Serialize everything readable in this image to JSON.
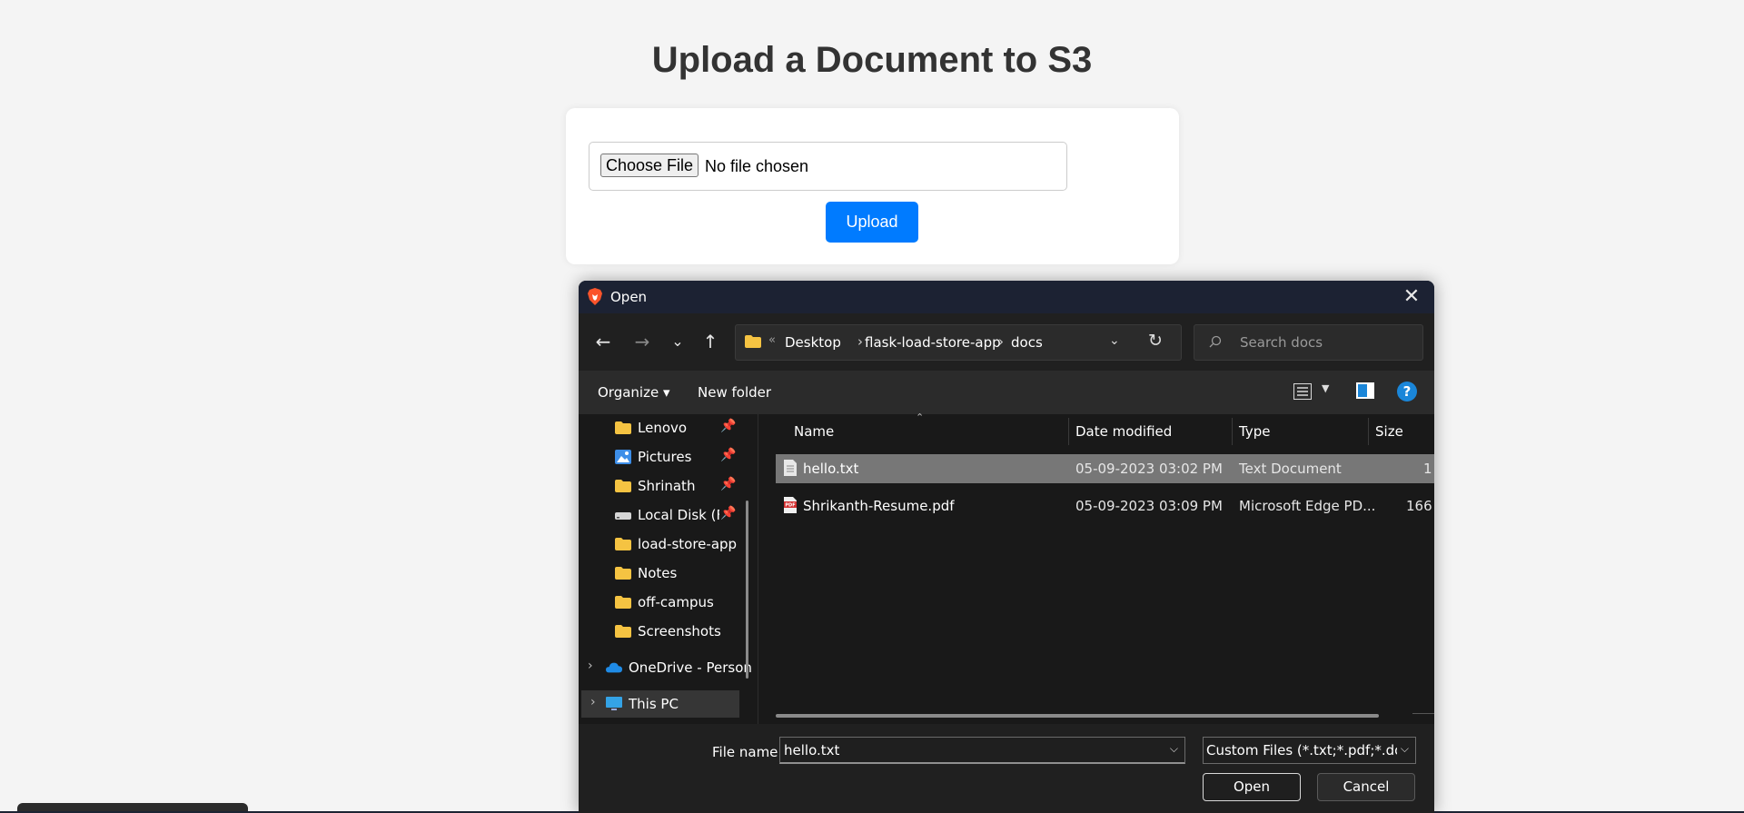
{
  "page": {
    "title": "Upload a Document to S3",
    "choose_file_label": "Choose File",
    "no_file_text": "No file chosen",
    "upload_label": "Upload"
  },
  "dialog": {
    "title": "Open",
    "close_glyph": "✕",
    "nav": {
      "back": "←",
      "forward": "→",
      "recent": "⌄",
      "up": "↑"
    },
    "address": {
      "overflow": "«",
      "crumbs": [
        "Desktop",
        "flask-load-store-app",
        "docs"
      ],
      "separator": "›"
    },
    "search_placeholder": "Search docs",
    "commands": {
      "organize": "Organize ▾",
      "new_folder": "New folder",
      "help": "?"
    },
    "nav_items": [
      {
        "label": "Lenovo",
        "icon": "folder-icon",
        "pinned": true
      },
      {
        "label": "Pictures",
        "icon": "pictures-icon",
        "pinned": true
      },
      {
        "label": "Shrinath",
        "icon": "folder-icon",
        "pinned": true
      },
      {
        "label": "Local Disk (F:)",
        "icon": "drive-icon",
        "pinned": true
      },
      {
        "label": "load-store-app",
        "icon": "folder-icon",
        "pinned": false
      },
      {
        "label": "Notes",
        "icon": "folder-icon",
        "pinned": false
      },
      {
        "label": "off-campus",
        "icon": "folder-icon",
        "pinned": false
      },
      {
        "label": "Screenshots",
        "icon": "folder-icon",
        "pinned": false
      },
      {
        "label": "OneDrive - Person",
        "icon": "onedrive-icon",
        "pinned": false
      },
      {
        "label": "This PC",
        "icon": "pc-icon",
        "pinned": false
      }
    ],
    "pin_glyph": "📌",
    "expand_glyph": "›",
    "columns": {
      "name": "Name",
      "date": "Date modified",
      "type": "Type",
      "size": "Size"
    },
    "files": [
      {
        "name": "hello.txt",
        "date": "05-09-2023 03:02 PM",
        "type": "Text Document",
        "size": "1",
        "selected": true,
        "icon": "text-file-icon"
      },
      {
        "name": "Shrikanth-Resume.pdf",
        "date": "05-09-2023 03:09 PM",
        "type": "Microsoft Edge PD...",
        "size": "166",
        "selected": false,
        "icon": "pdf-file-icon"
      }
    ],
    "footer": {
      "file_name_label": "File name:",
      "file_name_value": "hello.txt",
      "file_type_value": "Custom Files (*.txt;*.pdf;*.doc;*.docx)",
      "open_label": "Open",
      "cancel_label": "Cancel"
    }
  },
  "colors": {
    "page_bg": "#f4f4f4",
    "upload_button": "#007bff",
    "dialog_bg": "#202020",
    "titlebar": "#1c2233",
    "selected_row": "#777777",
    "folder_yellow": "#f5c342",
    "help_blue": "#1a86d9"
  }
}
